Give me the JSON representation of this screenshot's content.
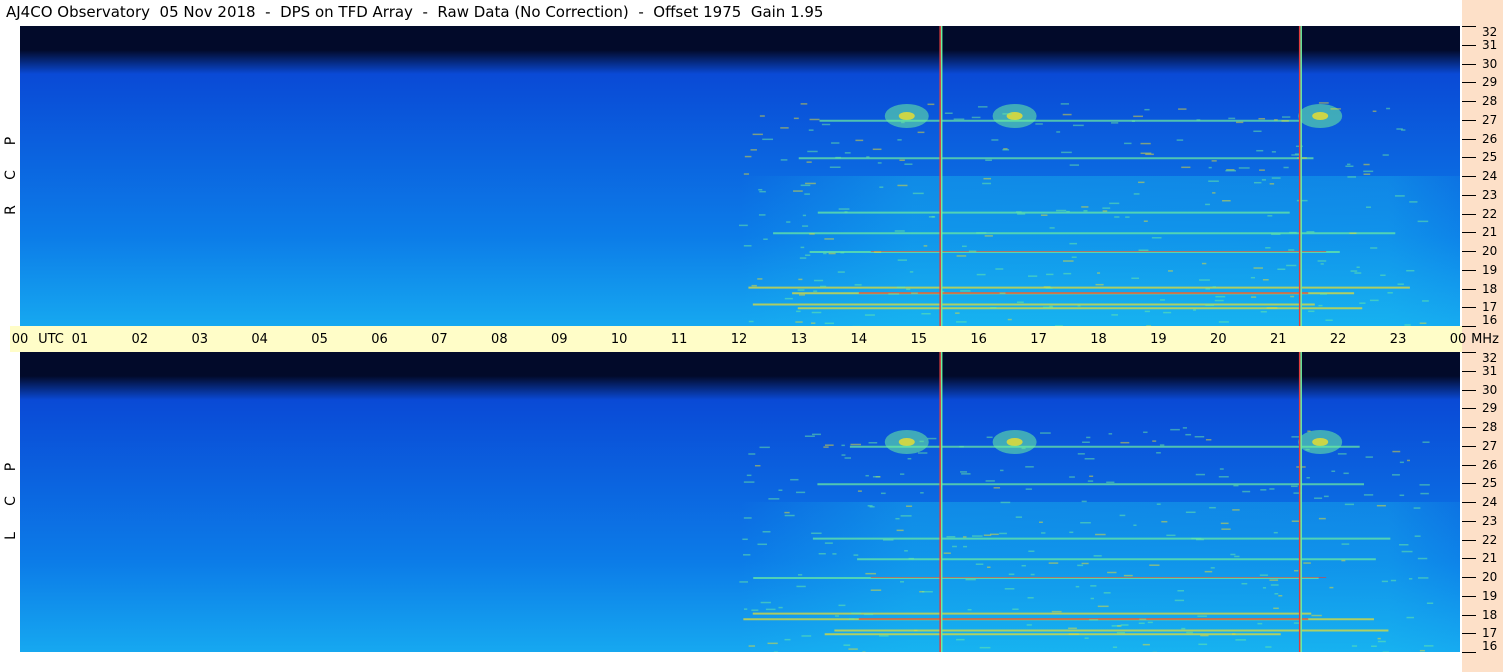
{
  "title": "AJ4CO Observatory  05 Nov 2018  -  DPS on TFD Array  -  Raw Data (No Correction)  -  Offset 1975  Gain 1.95",
  "panels": [
    {
      "label_letters": [
        "R",
        "C",
        "P"
      ]
    },
    {
      "label_letters": [
        "L",
        "C",
        "P"
      ]
    }
  ],
  "time_axis": {
    "labels": [
      "00",
      "UTC",
      "01",
      "02",
      "03",
      "04",
      "05",
      "06",
      "07",
      "08",
      "09",
      "10",
      "11",
      "12",
      "13",
      "14",
      "15",
      "16",
      "17",
      "18",
      "19",
      "20",
      "21",
      "22",
      "23",
      "00",
      "MHz"
    ]
  },
  "freq_axis": {
    "labels": [
      "32",
      "31",
      "30",
      "29",
      "28",
      "27",
      "26",
      "25",
      "24",
      "23",
      "22",
      "21",
      "20",
      "19",
      "18",
      "17",
      "16"
    ]
  },
  "colors": {
    "background_dark": "#020a2a",
    "background_blue": "#0a4ad6",
    "signal_cyan": "#19c8f0",
    "signal_green": "#6cf0a0",
    "signal_yellow": "#f0e02a",
    "signal_red": "#e43a3a",
    "axis_band": "#fffdc8",
    "right_strip": "#fde0c8"
  },
  "chart_data": {
    "type": "heatmap",
    "title": "AJ4CO Observatory  05 Nov 2018  -  DPS on TFD Array  -  Raw Data (No Correction)  -  Offset 1975  Gain 1.95",
    "xlabel": "UTC",
    "ylabel": "MHz",
    "x_ticks": [
      "00",
      "01",
      "02",
      "03",
      "04",
      "05",
      "06",
      "07",
      "08",
      "09",
      "10",
      "11",
      "12",
      "13",
      "14",
      "15",
      "16",
      "17",
      "18",
      "19",
      "20",
      "21",
      "22",
      "23",
      "00"
    ],
    "y_ticks": [
      32,
      31,
      30,
      29,
      28,
      27,
      26,
      25,
      24,
      23,
      22,
      21,
      20,
      19,
      18,
      17,
      16
    ],
    "xlim_hours_utc": [
      0,
      24
    ],
    "ylim_mhz": [
      16,
      32
    ],
    "series": [
      {
        "name": "RCP"
      },
      {
        "name": "LCP"
      }
    ],
    "vertical_interference_hours_utc": [
      15.37,
      21.37
    ],
    "bright_emission_hours_utc": [
      14.8,
      16.6,
      21.7
    ]
  }
}
